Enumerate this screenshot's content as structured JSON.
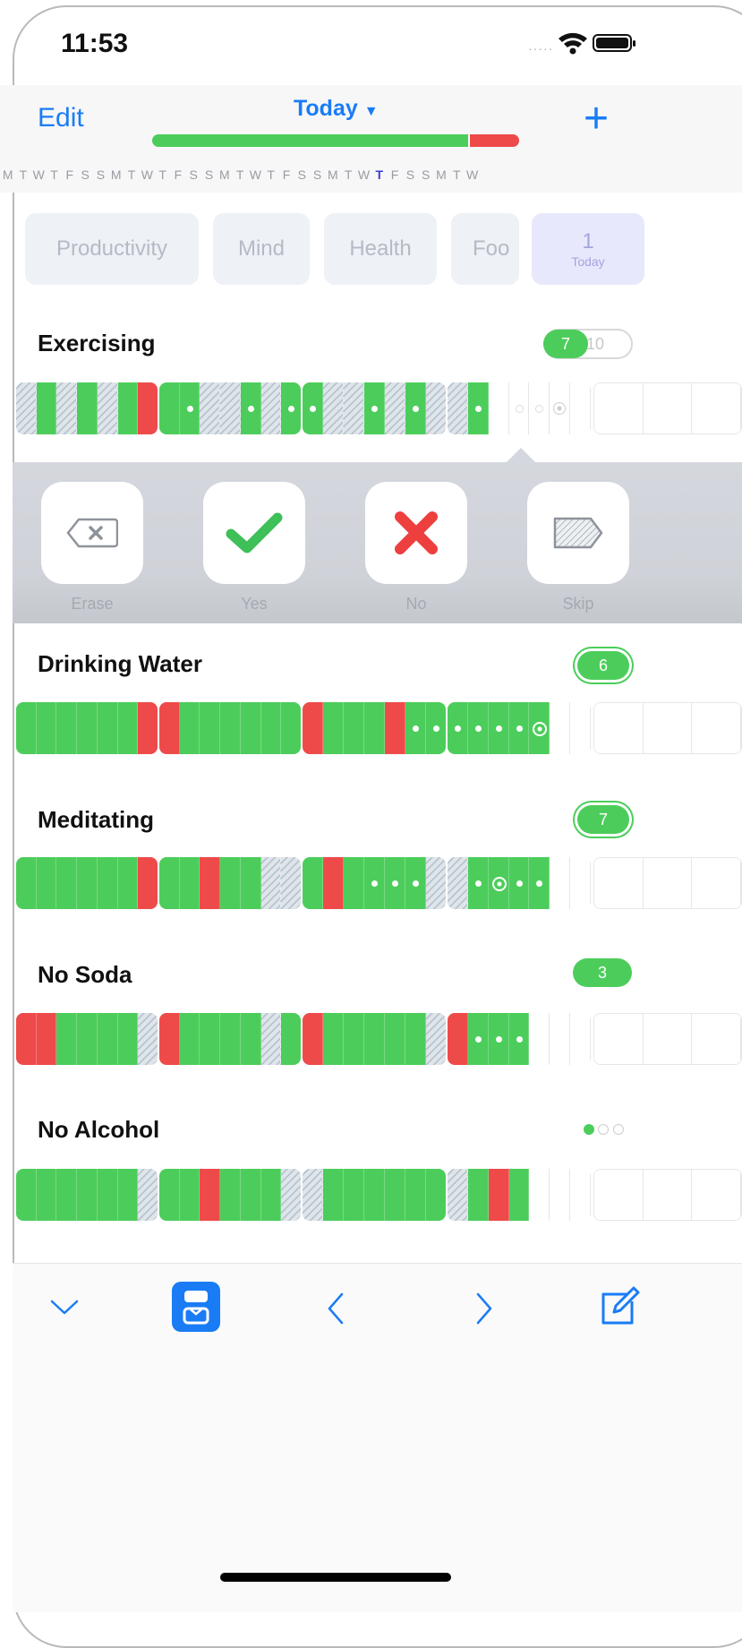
{
  "status_bar": {
    "time": "11:53"
  },
  "header": {
    "edit_label": "Edit",
    "title": "Today",
    "progress": {
      "done_fraction": 0.86,
      "failed_fraction": 0.14,
      "done_color": "#4ccd5b",
      "failed_color": "#ee4a4a"
    },
    "add_icon": "plus-icon",
    "weekday_letters": [
      "M",
      "T",
      "W",
      "T",
      "F",
      "S",
      "S",
      "M",
      "T",
      "W",
      "T",
      "F",
      "S",
      "S",
      "M",
      "T",
      "W",
      "T",
      "F",
      "S",
      "S",
      "M",
      "T",
      "W",
      "T",
      "F",
      "S",
      "S",
      "M",
      "T",
      "W"
    ],
    "current_day_index": 24
  },
  "categories": [
    {
      "label": "Productivity"
    },
    {
      "label": "Mind"
    },
    {
      "label": "Health"
    },
    {
      "label": "Foo"
    }
  ],
  "today_chip": {
    "count": "1",
    "label": "Today"
  },
  "habits": [
    {
      "name": "Exercising",
      "count": "7",
      "goal": "10"
    },
    {
      "name": "Drinking Water",
      "count": "6"
    },
    {
      "name": "Meditating",
      "count": "7"
    },
    {
      "name": "No Soda",
      "count": "3"
    },
    {
      "name": "No Alcohol"
    }
  ],
  "actions": [
    {
      "label": "Erase",
      "icon": "erase-icon"
    },
    {
      "label": "Yes",
      "icon": "checkmark-icon"
    },
    {
      "label": "No",
      "icon": "x-mark-icon"
    },
    {
      "label": "Skip",
      "icon": "skip-tag-icon"
    }
  ],
  "toolbar": {
    "icons": [
      "chevron-down-icon",
      "calendar-view-icon",
      "chevron-left-icon",
      "chevron-right-icon",
      "compose-icon"
    ],
    "accent": "#1a7cf5"
  }
}
